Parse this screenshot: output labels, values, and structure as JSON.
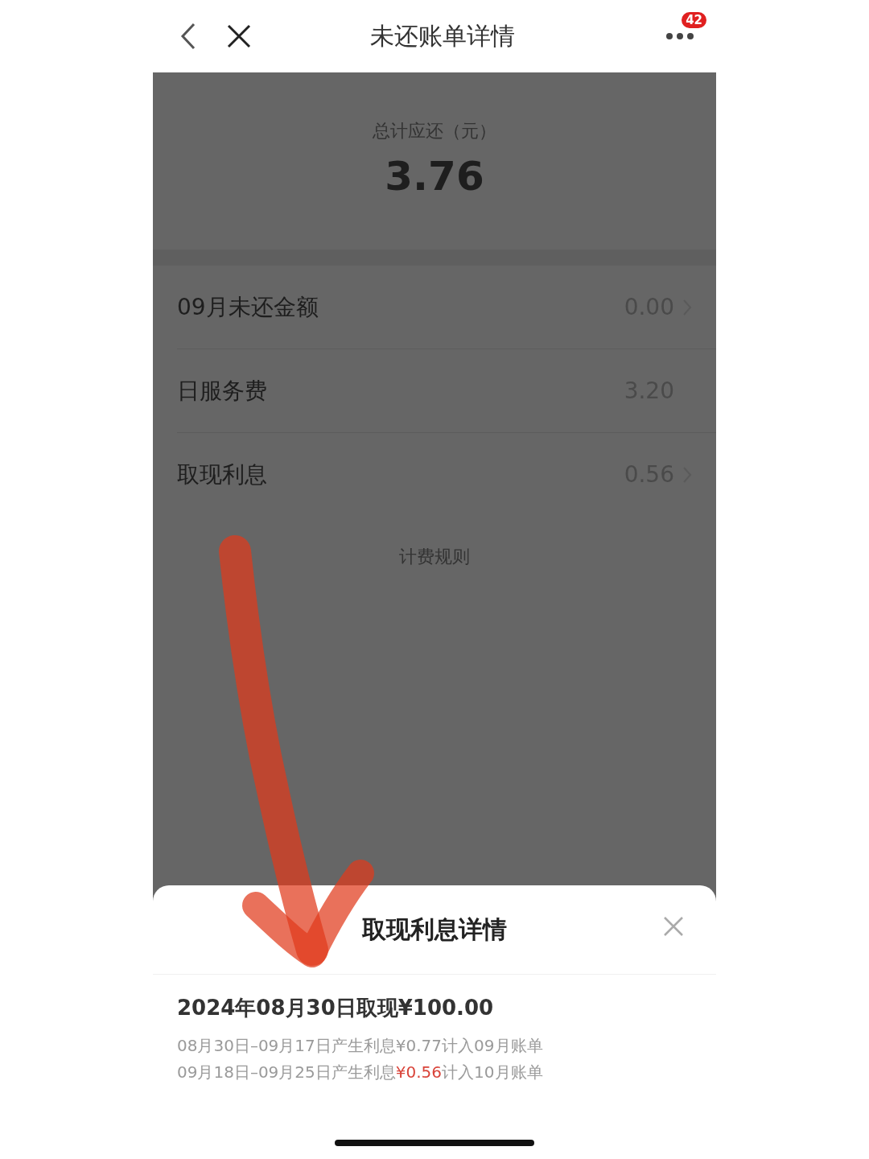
{
  "nav_bar": {
    "title": "未还账单详情",
    "badge": "42"
  },
  "summary": {
    "label": "总计应还（元）",
    "amount": "3.76"
  },
  "rows": [
    {
      "label": "09月未还金额",
      "value": "0.00",
      "chevron": true
    },
    {
      "label": "日服务费",
      "value": "3.20",
      "chevron": false
    },
    {
      "label": "取现利息",
      "value": "0.56",
      "chevron": true
    }
  ],
  "rules_link": "计费规则",
  "sheet": {
    "title": "取现利息详情",
    "entry_title": "2024年08月30日取现¥100.00",
    "lines": [
      {
        "parts": [
          {
            "text": "08月30日–09月17日产生利息¥0.77计入09月账单",
            "highlight": false
          }
        ]
      },
      {
        "parts": [
          {
            "text": "09月18日–09月25日产生利息",
            "highlight": false
          },
          {
            "text": "¥0.56",
            "highlight": true
          },
          {
            "text": "计入10月账单",
            "highlight": false
          }
        ]
      }
    ]
  }
}
